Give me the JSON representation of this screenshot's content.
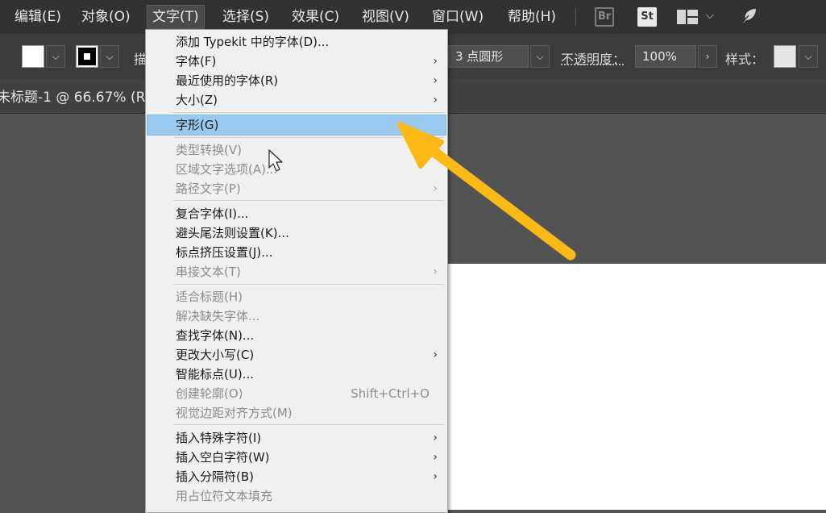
{
  "menubar": {
    "items": [
      "编辑(E)",
      "对象(O)",
      "文字(T)",
      "选择(S)",
      "效果(C)",
      "视图(V)",
      "窗口(W)",
      "帮助(H)"
    ],
    "br_icon": "Br",
    "st_icon": "St",
    "workspace_icon": "layout-icon",
    "sync_icon": "feather-icon"
  },
  "controlbar": {
    "stroke_prefix": "描",
    "brush": "3 点圆形",
    "opacity_label": "不透明度：",
    "opacity_value": "100%",
    "style_label": "样式：",
    "fill_color": "#ffffff",
    "stroke_color": "#000000"
  },
  "document": {
    "tab_title": "未标题-1 @ 66.67% (R"
  },
  "type_menu": {
    "items": [
      {
        "label": "添加 Typekit 中的字体(D)...",
        "enabled": true
      },
      {
        "label": "字体(F)",
        "enabled": true,
        "submenu": true
      },
      {
        "label": "最近使用的字体(R)",
        "enabled": true,
        "submenu": true
      },
      {
        "label": "大小(Z)",
        "enabled": true,
        "submenu": true
      },
      {
        "label": "字形(G)",
        "enabled": true,
        "highlighted": true
      },
      {
        "label": "类型转换(V)",
        "enabled": false
      },
      {
        "label": "区域文字选项(A)...",
        "enabled": false
      },
      {
        "label": "路径文字(P)",
        "enabled": false,
        "submenu": true
      },
      {
        "label": "复合字体(I)...",
        "enabled": true
      },
      {
        "label": "避头尾法则设置(K)...",
        "enabled": true
      },
      {
        "label": "标点挤压设置(J)...",
        "enabled": true
      },
      {
        "label": "串接文本(T)",
        "enabled": false,
        "submenu": true
      },
      {
        "label": "适合标题(H)",
        "enabled": false
      },
      {
        "label": "解决缺失字体...",
        "enabled": false
      },
      {
        "label": "查找字体(N)...",
        "enabled": true
      },
      {
        "label": "更改大小写(C)",
        "enabled": true,
        "submenu": true
      },
      {
        "label": "智能标点(U)...",
        "enabled": true
      },
      {
        "label": "创建轮廓(O)",
        "enabled": false,
        "shortcut": "Shift+Ctrl+O"
      },
      {
        "label": "视觉边距对齐方式(M)",
        "enabled": false
      },
      {
        "label": "插入特殊字符(I)",
        "enabled": true,
        "submenu": true
      },
      {
        "label": "插入空白字符(W)",
        "enabled": true,
        "submenu": true
      },
      {
        "label": "插入分隔符(B)",
        "enabled": true,
        "submenu": true
      },
      {
        "label": "用占位符文本填充",
        "enabled": false
      }
    ]
  },
  "annotation": {
    "arrow_color": "#fbb916",
    "cursor_icon": "mouse-pointer-icon"
  }
}
